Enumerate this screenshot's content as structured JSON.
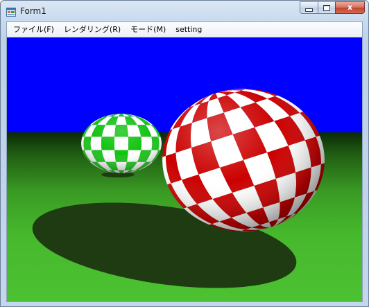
{
  "window": {
    "title": "Form1",
    "icon": "form-icon",
    "controls": {
      "minimize_icon": "minimize-icon",
      "maximize_icon": "maximize-icon",
      "close_label": "x"
    }
  },
  "menu": {
    "items": [
      {
        "label": "ファイル(F)"
      },
      {
        "label": "レンダリング(R)"
      },
      {
        "label": "モード(M)"
      },
      {
        "label": "setting"
      }
    ]
  },
  "scene": {
    "sky_color": "#0000ff",
    "floor_color": "#46b82c",
    "horizon_fade_color": "#0a2a05",
    "shadow_color": "#1e3b12",
    "spheres": [
      {
        "name": "green-checker-sphere",
        "colors": [
          "#11c411",
          "#ffffff"
        ]
      },
      {
        "name": "red-checker-sphere",
        "colors": [
          "#cc0000",
          "#ffffff"
        ]
      }
    ]
  }
}
